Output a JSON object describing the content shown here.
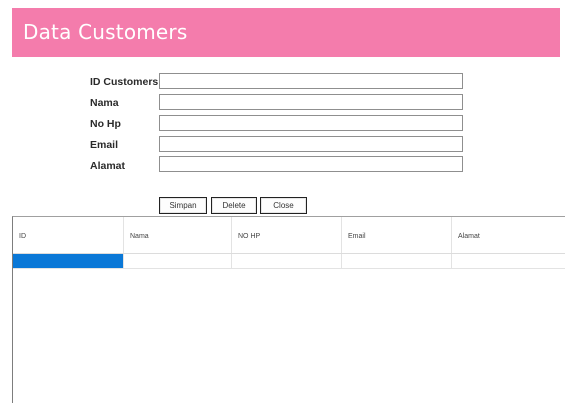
{
  "header": {
    "title": "Data Customers",
    "background_color": "#f47cac"
  },
  "form": {
    "fields": [
      {
        "label": "ID Customers",
        "value": ""
      },
      {
        "label": "Nama",
        "value": ""
      },
      {
        "label": "No Hp",
        "value": ""
      },
      {
        "label": "Email",
        "value": ""
      },
      {
        "label": "Alamat",
        "value": ""
      }
    ]
  },
  "buttons": {
    "simpan": "Simpan",
    "delete": "Delete",
    "close": "Close"
  },
  "grid": {
    "columns": [
      "ID",
      "Nama",
      "NO HP",
      "Email",
      "Alamat"
    ],
    "rows": [
      [
        "",
        "",
        "",
        "",
        ""
      ]
    ],
    "selection_color": "#0a78d7"
  }
}
